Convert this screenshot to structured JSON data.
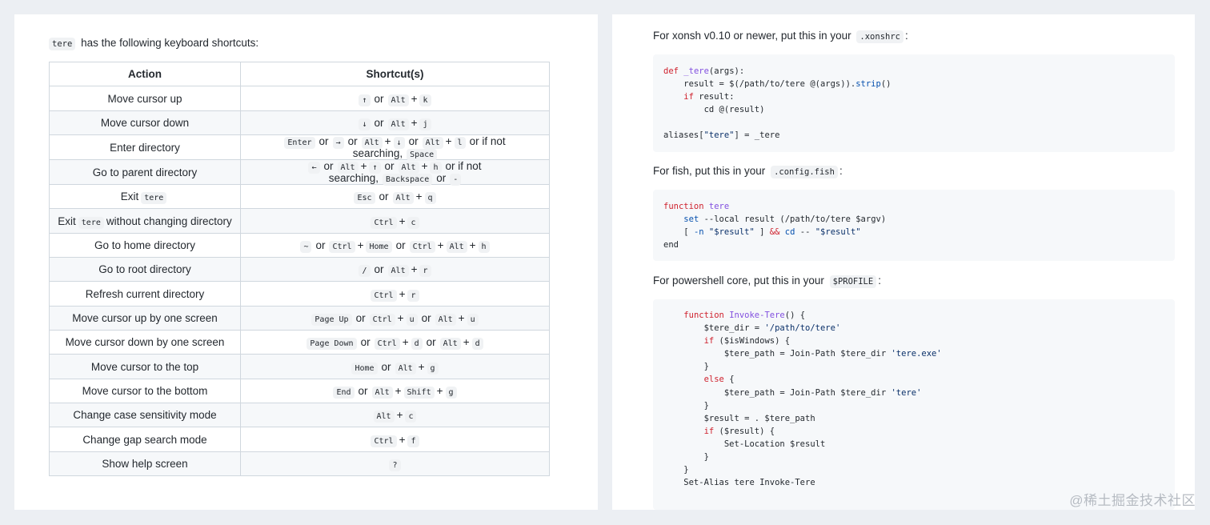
{
  "left": {
    "intro_code": "tere",
    "intro_text": "has the following keyboard shortcuts:",
    "headers": [
      "Action",
      "Shortcut(s)"
    ],
    "rows": [
      {
        "action": [
          "Move cursor up"
        ],
        "shortcut": [
          [
            "↑"
          ],
          "or",
          [
            "Alt",
            "k"
          ]
        ]
      },
      {
        "action": [
          "Move cursor down"
        ],
        "shortcut": [
          [
            "↓"
          ],
          "or",
          [
            "Alt",
            "j"
          ]
        ]
      },
      {
        "action": [
          "Enter directory"
        ],
        "shortcut": [
          [
            "Enter"
          ],
          "or",
          [
            "→"
          ],
          "or",
          [
            "Alt",
            "↓"
          ],
          "or",
          [
            "Alt",
            "l"
          ],
          "or if not searching,",
          [
            "Space"
          ]
        ]
      },
      {
        "action": [
          "Go to parent directory"
        ],
        "shortcut": [
          [
            "←"
          ],
          "or",
          [
            "Alt",
            "↑"
          ],
          "or",
          [
            "Alt",
            "h"
          ],
          "or if not searching,",
          [
            "Backspace"
          ],
          "or",
          [
            "-"
          ]
        ]
      },
      {
        "action": [
          "Exit",
          {
            "code": "tere"
          }
        ],
        "shortcut": [
          [
            "Esc"
          ],
          "or",
          [
            "Alt",
            "q"
          ]
        ]
      },
      {
        "action": [
          "Exit",
          {
            "code": "tere"
          },
          "without changing directory"
        ],
        "shortcut": [
          [
            "Ctrl",
            "c"
          ]
        ]
      },
      {
        "action": [
          "Go to home directory"
        ],
        "shortcut": [
          [
            "~"
          ],
          "or",
          [
            "Ctrl",
            "Home"
          ],
          "or",
          [
            "Ctrl",
            "Alt",
            "h"
          ]
        ]
      },
      {
        "action": [
          "Go to root directory"
        ],
        "shortcut": [
          [
            "/"
          ],
          "or",
          [
            "Alt",
            "r"
          ]
        ]
      },
      {
        "action": [
          "Refresh current directory"
        ],
        "shortcut": [
          [
            "Ctrl",
            "r"
          ]
        ]
      },
      {
        "action": [
          "Move cursor up by one screen"
        ],
        "shortcut": [
          [
            "Page Up"
          ],
          "or",
          [
            "Ctrl",
            "u"
          ],
          "or",
          [
            "Alt",
            "u"
          ]
        ]
      },
      {
        "action": [
          "Move cursor down by one screen"
        ],
        "shortcut": [
          [
            "Page Down"
          ],
          "or",
          [
            "Ctrl",
            "d"
          ],
          "or",
          [
            "Alt",
            "d"
          ]
        ]
      },
      {
        "action": [
          "Move cursor to the top"
        ],
        "shortcut": [
          [
            "Home"
          ],
          "or",
          [
            "Alt",
            "g"
          ]
        ]
      },
      {
        "action": [
          "Move cursor to the bottom"
        ],
        "shortcut": [
          [
            "End"
          ],
          "or",
          [
            "Alt",
            "Shift",
            "g"
          ]
        ]
      },
      {
        "action": [
          "Change case sensitivity mode"
        ],
        "shortcut": [
          [
            "Alt",
            "c"
          ]
        ]
      },
      {
        "action": [
          "Change gap search mode"
        ],
        "shortcut": [
          [
            "Ctrl",
            "f"
          ]
        ]
      },
      {
        "action": [
          "Show help screen"
        ],
        "shortcut": [
          [
            "?"
          ]
        ]
      }
    ]
  },
  "right": {
    "xonsh": {
      "text_before": "For xonsh v0.10 or newer, put this in your",
      "code": ".xonshrc",
      "text_after": ":"
    },
    "fish": {
      "text_before": "For fish, put this in your",
      "code": ".config.fish",
      "text_after": ":"
    },
    "powershell": {
      "text_before": "For powershell core, put this in your",
      "code": "$PROFILE",
      "text_after": ":"
    },
    "xonsh_code": [
      [
        [
          "kw",
          "def"
        ],
        [
          "",
          " "
        ],
        [
          "fn",
          "_tere"
        ],
        [
          "",
          "(args):"
        ]
      ],
      [
        [
          "",
          "    result = $(/path/to/tere @(args))."
        ],
        [
          "bl",
          "strip"
        ],
        [
          "",
          "()"
        ]
      ],
      [
        [
          "",
          "    "
        ],
        [
          "kw",
          "if"
        ],
        [
          "",
          " result:"
        ]
      ],
      [
        [
          "",
          "        cd @(result)"
        ]
      ],
      [
        [
          "",
          ""
        ]
      ],
      [
        [
          "",
          "aliases["
        ],
        [
          "st",
          "\"tere\""
        ],
        [
          "",
          "] = _tere"
        ]
      ]
    ],
    "fish_code": [
      [
        [
          "kw",
          "function"
        ],
        [
          "",
          " "
        ],
        [
          "fn",
          "tere"
        ]
      ],
      [
        [
          "",
          "    "
        ],
        [
          "bl",
          "set"
        ],
        [
          "",
          " --local result (/path/to/tere $argv)"
        ]
      ],
      [
        [
          "",
          "    [ "
        ],
        [
          "bl",
          "-n"
        ],
        [
          "",
          " "
        ],
        [
          "st",
          "\"$result\""
        ],
        [
          "",
          " ] "
        ],
        [
          "kw",
          "&&"
        ],
        [
          "",
          " "
        ],
        [
          "bl",
          "cd"
        ],
        [
          "",
          " -- "
        ],
        [
          "st",
          "\"$result\""
        ]
      ],
      [
        [
          "",
          "end"
        ]
      ]
    ],
    "ps_code": [
      [
        [
          "",
          "    "
        ],
        [
          "kw",
          "function"
        ],
        [
          "",
          " "
        ],
        [
          "fn",
          "Invoke-Tere"
        ],
        [
          "",
          "() {"
        ]
      ],
      [
        [
          "",
          "        $tere_dir = "
        ],
        [
          "st",
          "'/path/to/tere'"
        ]
      ],
      [
        [
          "",
          "        "
        ],
        [
          "kw",
          "if"
        ],
        [
          "",
          " ($isWindows) {"
        ]
      ],
      [
        [
          "",
          "            $tere_path = Join-Path $tere_dir "
        ],
        [
          "st",
          "'tere.exe'"
        ]
      ],
      [
        [
          "",
          "        }"
        ]
      ],
      [
        [
          "",
          "        "
        ],
        [
          "kw",
          "else"
        ],
        [
          "",
          " {"
        ]
      ],
      [
        [
          "",
          "            $tere_path = Join-Path $tere_dir "
        ],
        [
          "st",
          "'tere'"
        ]
      ],
      [
        [
          "",
          "        }"
        ]
      ],
      [
        [
          "",
          "        $result = . $tere_path"
        ]
      ],
      [
        [
          "",
          "        "
        ],
        [
          "kw",
          "if"
        ],
        [
          "",
          " ($result) {"
        ]
      ],
      [
        [
          "",
          "            Set-Location $result"
        ]
      ],
      [
        [
          "",
          "        }"
        ]
      ],
      [
        [
          "",
          "    }"
        ]
      ],
      [
        [
          "",
          "    Set-Alias tere Invoke-Tere"
        ]
      ]
    ]
  },
  "watermark": "@稀土掘金技术社区"
}
